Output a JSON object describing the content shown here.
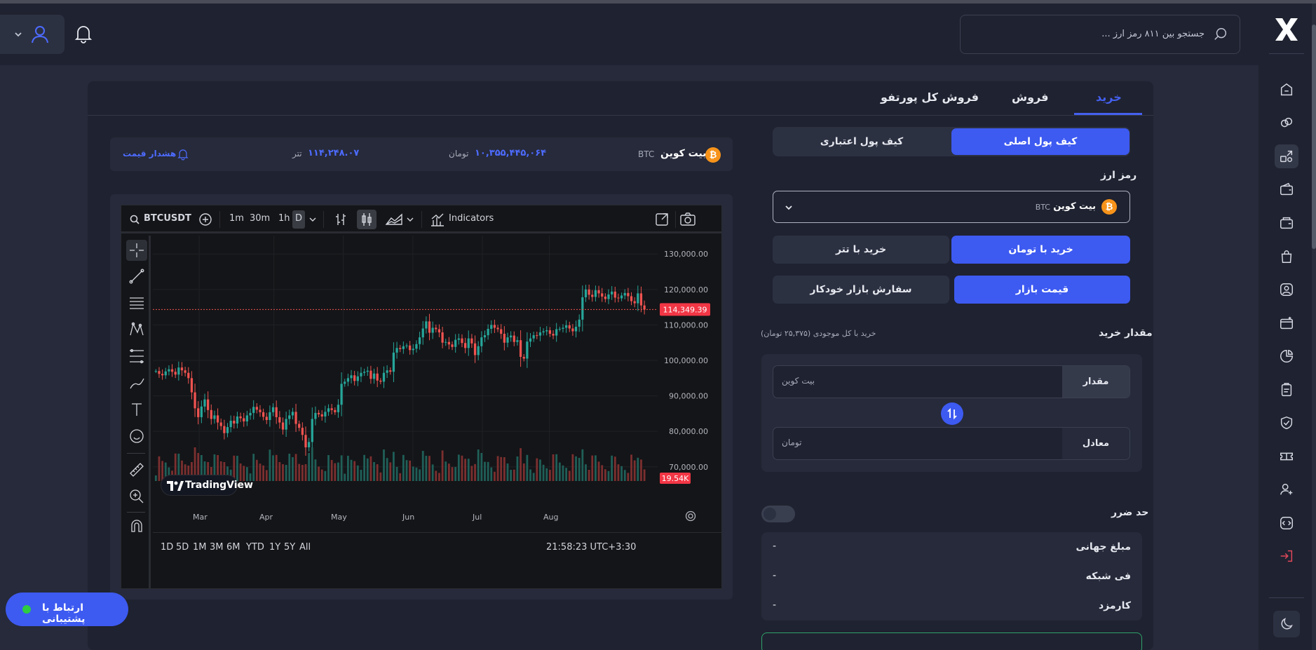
{
  "app": {
    "name": "X",
    "colors": {
      "accent": "#3d5af1",
      "bg": "#262a3a",
      "panel": "#1f2230",
      "candle_up": "#26a69a",
      "candle_down": "#ef5350"
    }
  },
  "header": {
    "search_placeholder": "جستجو بین ۸۱۱ رمز ارز ...",
    "search_icon": "search-icon",
    "notification_icon": "bell-icon",
    "user_icon": "user-icon"
  },
  "sidebar": {
    "items": [
      "home-icon",
      "coins-icon",
      "exchange-icon",
      "wallet-icon",
      "wallet-2-icon",
      "bag-icon",
      "profile-icon",
      "card-add-icon",
      "pie-chart-icon",
      "clipboard-icon",
      "shield-check-icon",
      "ticket-icon",
      "user-add-icon",
      "code-icon",
      "logout-icon"
    ],
    "theme_icon": "moon-icon"
  },
  "tabs": [
    {
      "label": "خرید",
      "active": true
    },
    {
      "label": "فروش",
      "active": false
    },
    {
      "label": "فروش کل پورتفو",
      "active": false
    }
  ],
  "info": {
    "coin_name": "بیت کوین",
    "coin_symbol": "BTC",
    "price_toman": "۱۰,۳۵۵,۴۴۵,۰۶۴",
    "toman_unit": "تومان",
    "price_tether": "۱۱۴,۲۴۸.۰۷",
    "tether_unit": "تتر",
    "alert_label": "هشدار قیمت"
  },
  "tv": {
    "symbol": "BTCUSDT",
    "intervals": [
      "1m",
      "30m",
      "1h",
      "D"
    ],
    "active_interval": "D",
    "indicators_label": "Indicators",
    "brand": "TradingView",
    "ranges": [
      "1D",
      "5D",
      "1M",
      "3M",
      "6M",
      "YTD",
      "1Y",
      "5Y",
      "All"
    ],
    "time": "21:58:23 UTC+3:30",
    "price_tag": "114,349.39",
    "volume_tag": "19.54K"
  },
  "chart_data": {
    "type": "candlestick",
    "x_labels": [
      "Mar",
      "Apr",
      "May",
      "Jun",
      "Jul",
      "Aug"
    ],
    "y_ticks": [
      "130,000.00",
      "120,000.00",
      "110,000.00",
      "100,000.00",
      "90,000.00",
      "80,000.00",
      "70,000.00"
    ],
    "ylim": [
      66000,
      134000
    ],
    "last_price": 114349.39,
    "closes": [
      97000,
      96200,
      95800,
      96900,
      97500,
      96800,
      96000,
      98000,
      97200,
      96500,
      95000,
      91000,
      86500,
      84000,
      87000,
      89000,
      86000,
      83500,
      84500,
      82500,
      81500,
      79500,
      81200,
      83000,
      82200,
      84200,
      83700,
      82800,
      84500,
      85200,
      86900,
      86100,
      85400,
      84100,
      83200,
      85400,
      86800,
      84000,
      82500,
      80500,
      83500,
      84500,
      85500,
      82100,
      81000,
      79000,
      75500,
      77000,
      83500,
      85200,
      84800,
      84200,
      85500,
      86500,
      86000,
      85400,
      87500,
      93400,
      94000,
      95000,
      95800,
      94200,
      95500,
      96500,
      96800,
      97100,
      94800,
      96300,
      94300,
      94000,
      96500,
      97200,
      96800,
      102200,
      103500,
      103200,
      104000,
      104200,
      102900,
      103300,
      104600,
      106500,
      109000,
      111000,
      107800,
      109200,
      108800,
      107900,
      105000,
      105200,
      104500,
      103800,
      105800,
      106200,
      104900,
      103500,
      106200,
      104800,
      101500,
      104000,
      106500,
      107100,
      108900,
      110000,
      109200,
      108800,
      107500,
      105000,
      106500,
      107000,
      105200,
      105700,
      101000,
      100500,
      105300,
      106200,
      107100,
      107000,
      107900,
      108200,
      108500,
      107500,
      107000,
      108800,
      108900,
      109200,
      109900,
      109000,
      108200,
      109500,
      111500,
      117800,
      120000,
      118500,
      117900,
      119800,
      118900,
      118000,
      117300,
      118600,
      119400,
      117700,
      117500,
      118300,
      119000,
      118100,
      116700,
      116100,
      118900,
      115500,
      114349
    ],
    "volume_tag": "19.54K"
  },
  "wallet_tabs": {
    "main": "کیف پول اصلی",
    "credit": "کیف پول اعتباری"
  },
  "currency": {
    "label": "رمز ارز",
    "selected_name": "بیت کوین",
    "selected_symbol": "BTC"
  },
  "buy_with": {
    "toman": "خرید با تومان",
    "tether": "خرید با تتر"
  },
  "order_type": {
    "market": "قیمت بازار",
    "auto": "سفارش بازار خودکار"
  },
  "amount": {
    "label": "مقدار خرید",
    "hint": "خرید با کل موجودی (۲۵,۳۷۵ تومان)",
    "qty_label": "مقدار",
    "qty_placeholder": "بیت کوین",
    "eq_label": "معادل",
    "eq_placeholder": "تومان"
  },
  "stop_loss": {
    "label": "حد ضرر",
    "enabled": false
  },
  "summary": [
    {
      "label": "مبلغ جهانی",
      "value": "-"
    },
    {
      "label": "فی شبکه",
      "value": "-"
    },
    {
      "label": "کارمزد",
      "value": "-"
    }
  ],
  "support": {
    "label": "ارتباط با پشتیبانی"
  }
}
